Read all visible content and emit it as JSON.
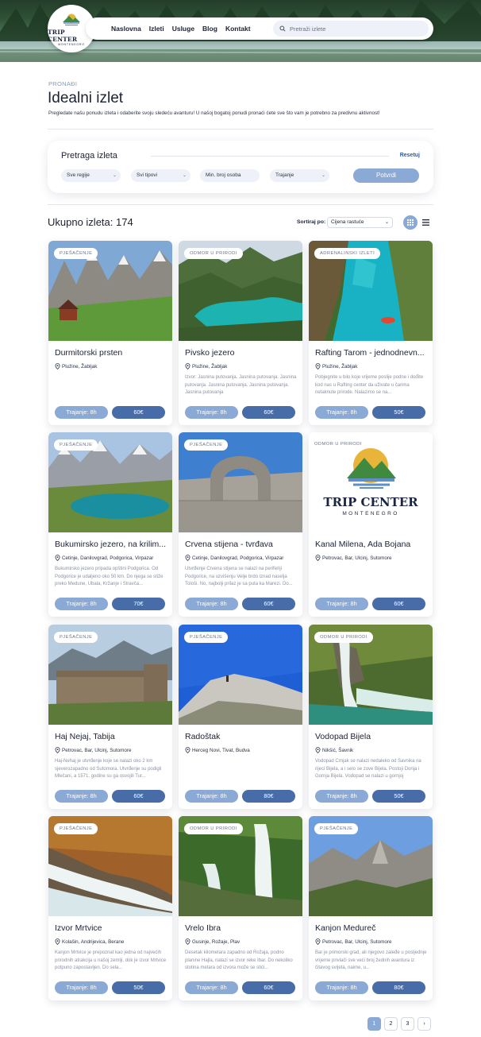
{
  "nav": {
    "logo_title": "TRIP CENTER",
    "logo_subtitle": "MONTENEGRO",
    "links": [
      "Naslovna",
      "Izleti",
      "Usluge",
      "Blog",
      "Kontakt"
    ],
    "search_placeholder": "Pretraži izlete"
  },
  "header": {
    "eyebrow": "PRONAĐI",
    "title": "Idealni izlet",
    "description": "Pregledate našu ponudu izleta i odaberite svoju sledeću avanturu! U našoj bogatoj ponudi pronaći ćete sve što vam je potrebno za predivnu aktivnost!"
  },
  "filters": {
    "title": "Pretraga izleta",
    "reset_label": "Resetuj",
    "region_select": "Sve regije",
    "type_select": "Svi tipovi",
    "min_people_placeholder": "Min. broj osoba",
    "duration_select": "Trajanje",
    "submit_label": "Potvrdi"
  },
  "results": {
    "count_label": "Ukupno izleta: 174",
    "sort_label": "Sortiraj po:",
    "sort_value": "Cijena rastuće"
  },
  "cards": [
    {
      "badge": "PJEŠAČENJE",
      "title": "Durmitorski prsten",
      "location": "Plužine, Žabljak",
      "description": "",
      "duration": "Trajanje: 8h",
      "price": "60€"
    },
    {
      "badge": "ODMOR U PRIRODI",
      "title": "Pivsko jezero",
      "location": "Plužine, Žabljak",
      "description": "Izvor: Jasnina putovanja. Jasnina putovanja. Jasnina putovanja. Jasnina putovanja. Jasnina putovanja. Jasnina putovanja",
      "duration": "Trajanje: 8h",
      "price": "60€"
    },
    {
      "badge": "ADRENALINSKI IZLETI",
      "title": "Rafting Tarom - jednodnevn...",
      "location": "Plužine, Žabljak",
      "description": "Pobjegnite u bilo koje vrijeme poslije podne i dođite kod nas u Rafting center da uživate u čarima netaknute prirode. Nalazimo se na...",
      "duration": "Trajanje: 8h",
      "price": "50€"
    },
    {
      "badge": "PJEŠAČENJE",
      "title": "Bukumirsko jezero, na krilim...",
      "location": "Cetinje, Danilovgrad, Podgorica, Virpazar",
      "description": "Bukumirsko jezero pripada opštini Podgorica. Od Podgorice je udaljeno oko 50 km. Do njega se stiže preko Medune, Ubala, Kržanje i Stravča...",
      "duration": "Trajanje: 8h",
      "price": "70€"
    },
    {
      "badge": "PJEŠAČENJE",
      "title": "Crvena stijena - tvrđava",
      "location": "Cetinje, Danilovgrad, Podgorica, Virpazar",
      "description": "Utvrđenje Crvena stijena se nalazi na periferiji Podgorice, na uzvišenju Velje brdo iznad naselja Tološi. No, najbolji prilaz je sa puta ka Marezi. Do...",
      "duration": "Trajanje: 8h",
      "price": "60€"
    },
    {
      "badge": "ODMOR U PRIRODI",
      "title": "Kanal Milena, Ada Bojana",
      "location": "Petrovac, Bar, Ulcinj, Sutomore",
      "description": "",
      "duration": "Trajanje: 8h",
      "price": "60€"
    },
    {
      "badge": "PJEŠAČENJE",
      "title": "Haj Nejaj, Tabija",
      "location": "Petrovac, Bar, Ulcinj, Sutomore",
      "description": "Haj-Nehaj je utvrđenje koje se nalazi oko 2 km sjeverozapadno od Sutomora. Utvrđenje su podigli Mlečani, a 1571. godine su ga osvojili Tur...",
      "duration": "Trajanje: 8h",
      "price": "60€"
    },
    {
      "badge": "PJEŠAČENJE",
      "title": "Radoštak",
      "location": "Herceg Novi, Tivat, Budva",
      "description": "",
      "duration": "Trajanje: 8h",
      "price": "80€"
    },
    {
      "badge": "ODMOR U PRIRODI",
      "title": "Vodopad Bijela",
      "location": "Nikšić, Šavnik",
      "description": "Vodopad Crnjak se nalazi nedaleko od Šavnika na rijeci Bijela, a i selo se zove Bijela. Postoji Donja i Gornja Bijela. Vodopad se nalazi u gornjoj",
      "duration": "Trajanje: 8h",
      "price": "50€"
    },
    {
      "badge": "PJEŠAČENJE",
      "title": "Izvor Mrtvice",
      "location": "Kolašin, Andrijevica, Berane",
      "description": "Kanjon Mrtvice je prepoznat kao jedna od najvećih prirodnih atrakcija u našoj zemlji, dok je izvor Mrtvice potpuno zapostavljen. Do sela...",
      "duration": "Trajanje: 8h",
      "price": "50€"
    },
    {
      "badge": "ODMOR U PRIRODI",
      "title": "Vrelo Ibra",
      "location": "Gusinje, Rožaje, Plav",
      "description": "Desetak kilometara zapadno od Rožaja, podno planine Hajla, nalazi se izvor reke Ibar. Do nekoliko stotina metara od izvora može se stići...",
      "duration": "Trajanje: 8h",
      "price": "60€"
    },
    {
      "badge": "PJEŠAČENJE",
      "title": "Kanjon Medureč",
      "location": "Petrovac, Bar, Ulcinj, Sutomore",
      "description": "Bar je primorski grad, ali njegovo zaleđe u posljednje vrijeme privlači sve veći broj žednih avantura iz čitavog svijeta, naime, u...",
      "duration": "Trajanje: 8h",
      "price": "80€"
    }
  ],
  "logo_card": {
    "title": "TRIP CENTER",
    "subtitle": "MONTENEGRO"
  },
  "pagination": [
    "1",
    "2",
    "3",
    "›"
  ],
  "colors": {
    "accent": "#8ba9d5",
    "primary": "#476ca7",
    "link": "#2c5aa8"
  }
}
